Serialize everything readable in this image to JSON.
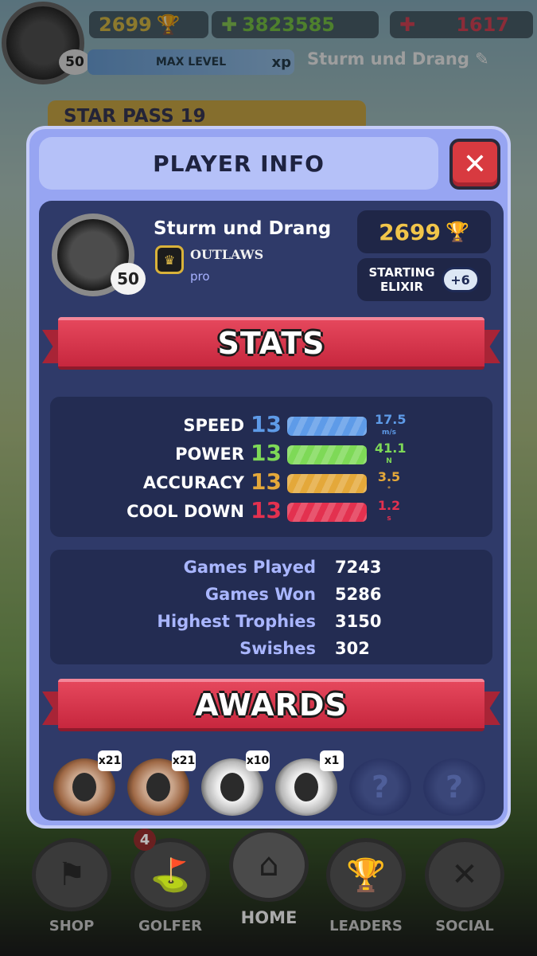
{
  "hud": {
    "level": "50",
    "trophies": "2699",
    "cash": "3823585",
    "gems": "1617",
    "xp_label": "MAX LEVEL",
    "xp_suffix": "xp",
    "player_name": "Sturm und Drang",
    "star_pass": "STAR PASS 19"
  },
  "modal": {
    "title": "PLAYER INFO",
    "close_label": "✕"
  },
  "player": {
    "name": "Sturm und Drang",
    "level": "50",
    "club": "OUTLAWS",
    "rank": "pro",
    "trophies": "2699",
    "elixir_label_1": "STARTING",
    "elixir_label_2": "ELIXIR",
    "elixir_value": "+6"
  },
  "stats_header": "STATS",
  "stats": [
    {
      "label": "SPEED",
      "level": "13",
      "value": "17.5",
      "unit": "m/s",
      "color": "#5e9be8"
    },
    {
      "label": "POWER",
      "level": "13",
      "value": "41.1",
      "unit": "N",
      "color": "#7ed957"
    },
    {
      "label": "ACCURACY",
      "level": "13",
      "value": "3.5",
      "unit": "°",
      "color": "#e4a83a"
    },
    {
      "label": "COOL DOWN",
      "level": "13",
      "value": "1.2",
      "unit": "s",
      "color": "#e3314f"
    }
  ],
  "counts": [
    {
      "label": "Games Played",
      "value": "7243"
    },
    {
      "label": "Games Won",
      "value": "5286"
    },
    {
      "label": "Highest Trophies",
      "value": "3150"
    },
    {
      "label": "Swishes",
      "value": "302"
    }
  ],
  "awards_header": "AWARDS",
  "awards": [
    {
      "tier": "bronze",
      "count": "x21"
    },
    {
      "tier": "bronze",
      "count": "x21"
    },
    {
      "tier": "silver",
      "count": "x10"
    },
    {
      "tier": "silver",
      "count": "x1"
    },
    {
      "tier": "locked",
      "count": "?"
    },
    {
      "tier": "locked",
      "count": "?"
    }
  ],
  "nav": [
    {
      "label": "SHOP",
      "icon": "flag-icon"
    },
    {
      "label": "GOLFER",
      "icon": "golfer-icon",
      "badge": "4"
    },
    {
      "label": "HOME",
      "icon": "house-icon"
    },
    {
      "label": "LEADERS",
      "icon": "trophy-icon"
    },
    {
      "label": "SOCIAL",
      "icon": "crossed-clubs-icon"
    }
  ]
}
